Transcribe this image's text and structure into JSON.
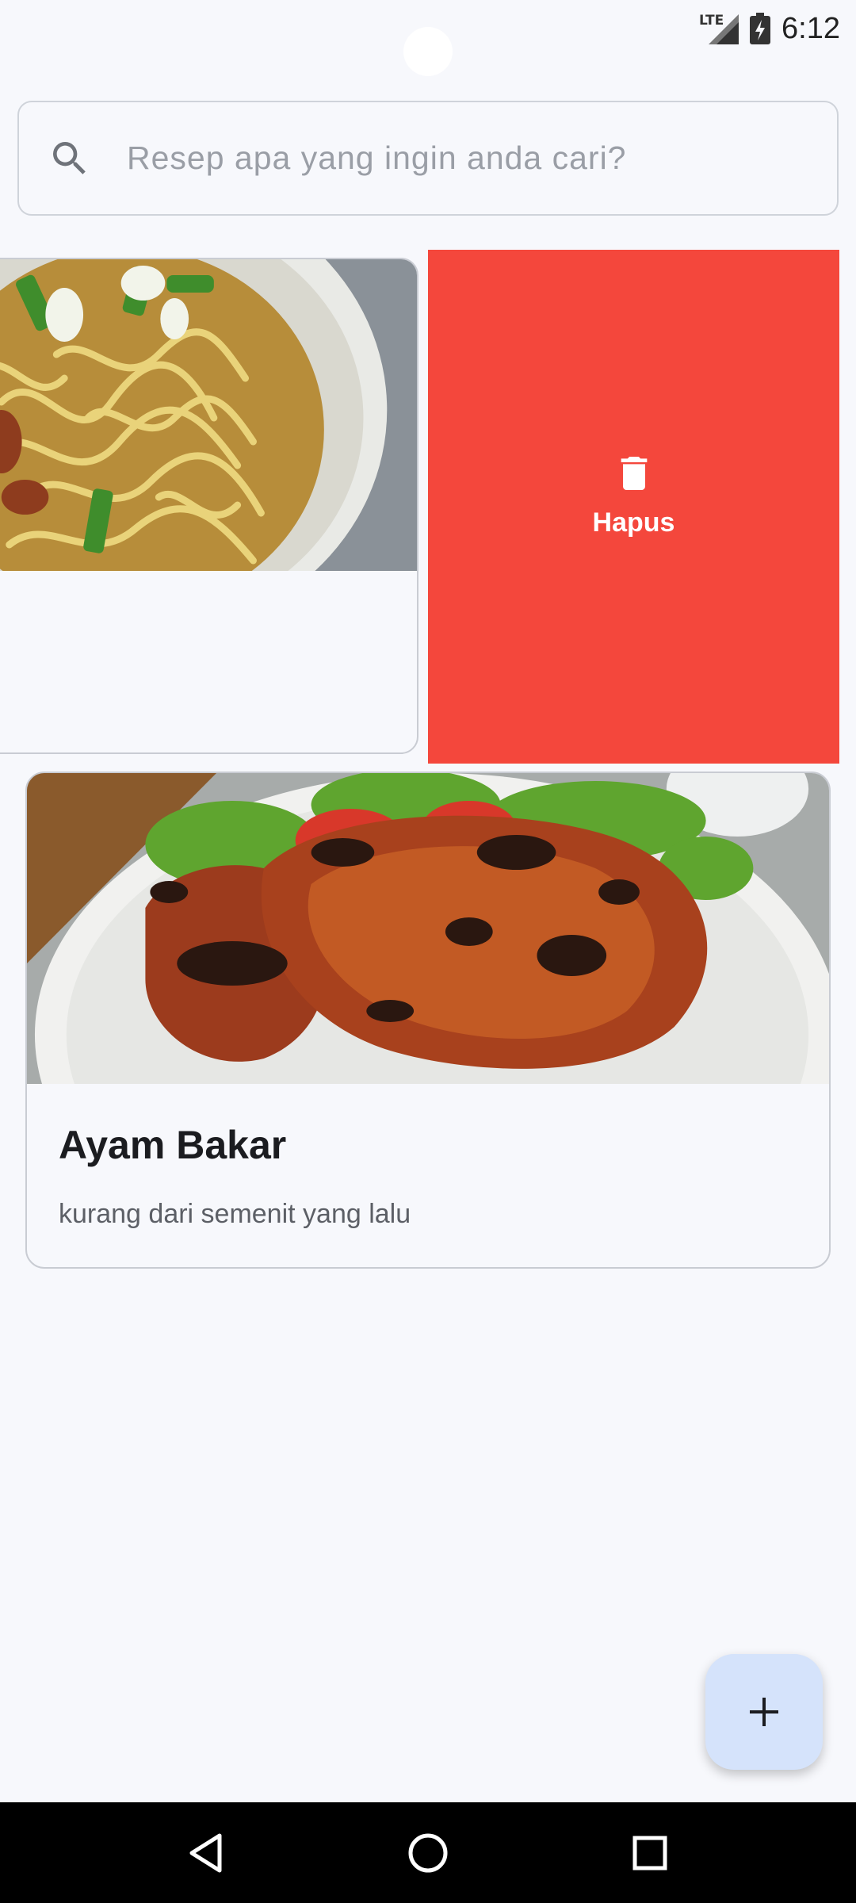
{
  "status_bar": {
    "network": "LTE",
    "time": "6:12"
  },
  "search": {
    "placeholder": "Resep apa yang ingin anda cari?",
    "value": ""
  },
  "swipe_action": {
    "label": "Hapus",
    "icon": "trash-icon",
    "color": "#f4473c"
  },
  "recipes": [
    {
      "title": "Ayam Bakar",
      "time_label": "kurang dari semenit yang lalu",
      "image": "grilled-chicken-photo"
    }
  ],
  "swiped_recipe": {
    "image": "noodle-soup-photo"
  },
  "fab": {
    "icon": "plus-icon",
    "color": "#d5e3fb"
  },
  "navigation": {
    "back": "back-icon",
    "home": "home-icon",
    "recents": "recents-icon"
  }
}
